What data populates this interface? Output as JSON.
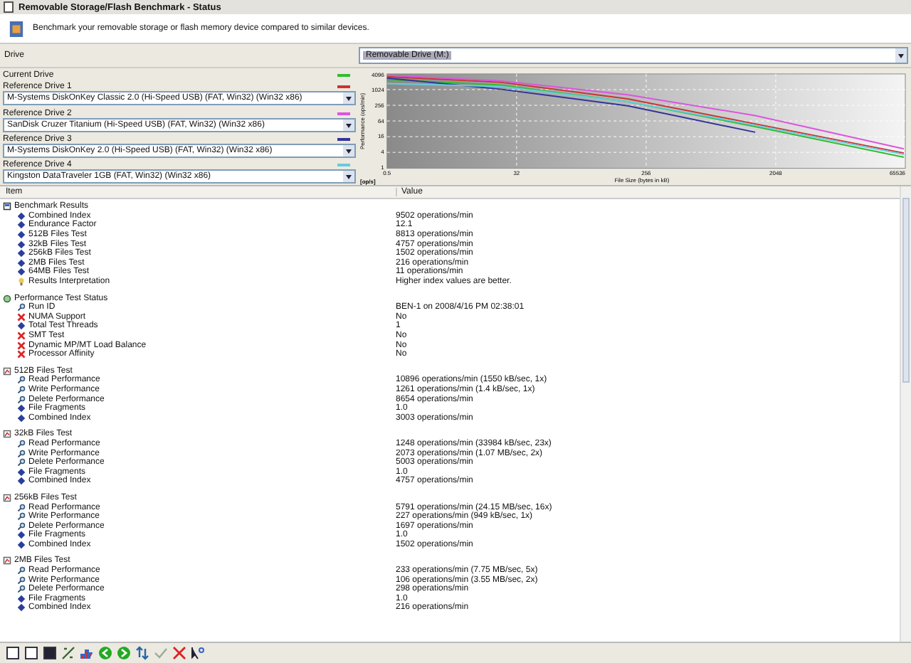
{
  "window": {
    "title": "Removable Storage/Flash Benchmark - Status"
  },
  "header": {
    "description": "Benchmark your removable storage or flash memory device compared to similar devices."
  },
  "drive": {
    "label": "Drive",
    "value": "Removable Drive (M:)"
  },
  "drives": [
    {
      "label": "Current Drive",
      "color": "#33bb33"
    },
    {
      "label": "Reference Drive 1",
      "color": "#cc3333",
      "value": "M-Systems DiskOnKey Classic 2.0 (Hi-Speed USB) (FAT, Win32) (Win32 x86)"
    },
    {
      "label": "Reference Drive 2",
      "color": "#dd55dd",
      "value": "SanDisk Cruzer Titanium (Hi-Speed USB) (FAT, Win32) (Win32 x86)"
    },
    {
      "label": "Reference Drive 3",
      "color": "#333399",
      "value": "M-Systems DiskOnKey 2.0 (Hi-Speed USB) (FAT, Win32) (Win32 x86)"
    },
    {
      "label": "Reference Drive 4",
      "color": "#66ccdd",
      "value": "Kingston DataTraveler 1GB (FAT, Win32) (Win32 x86)"
    }
  ],
  "chart": {
    "ylabel": "Performance (ops/min)",
    "xlabel": "File Size (bytes in kB)",
    "unit": "[op/s]",
    "yticks": [
      "4096",
      "1024",
      "256",
      "64",
      "16",
      "4",
      "1"
    ],
    "xticks": [
      "0.5",
      "32",
      "256",
      "2048",
      "65536"
    ]
  },
  "table": {
    "columns": [
      "Item",
      "Value"
    ],
    "sections": [
      {
        "label": "Benchmark Results",
        "kind": "results",
        "children": [
          {
            "label": "Combined Index",
            "value": "9502 operations/min",
            "kind": "result"
          },
          {
            "label": "Endurance Factor",
            "value": "12.1",
            "kind": "result"
          },
          {
            "label": "512B Files Test",
            "value": "8813 operations/min",
            "kind": "result"
          },
          {
            "label": "32kB Files Test",
            "value": "4757 operations/min",
            "kind": "result"
          },
          {
            "label": "256kB Files Test",
            "value": "1502 operations/min",
            "kind": "result"
          },
          {
            "label": "2MB Files Test",
            "value": "216 operations/min",
            "kind": "result"
          },
          {
            "label": "64MB Files Test",
            "value": "11 operations/min",
            "kind": "result"
          },
          {
            "label": "Results Interpretation",
            "value": "Higher index values are better.",
            "kind": "tip"
          }
        ]
      },
      {
        "label": "Performance Test Status",
        "kind": "status",
        "children": [
          {
            "label": "Run ID",
            "value": "BEN-1 on 2008/4/16 PM 02:38:01",
            "kind": "measure"
          },
          {
            "label": "NUMA Support",
            "value": "No",
            "kind": "unsupported"
          },
          {
            "label": "Total Test Threads",
            "value": "1",
            "kind": "result"
          },
          {
            "label": "SMT Test",
            "value": "No",
            "kind": "unsupported"
          },
          {
            "label": "Dynamic MP/MT Load Balance",
            "value": "No",
            "kind": "unsupported"
          },
          {
            "label": "Processor Affinity",
            "value": "No",
            "kind": "unsupported"
          }
        ]
      },
      {
        "label": "512B Files Test",
        "kind": "test",
        "children": [
          {
            "label": "Read Performance",
            "value": "10896 operations/min (1550 kB/sec, 1x)",
            "kind": "measure"
          },
          {
            "label": "Write Performance",
            "value": "1261 operations/min (1.4 kB/sec, 1x)",
            "kind": "measure"
          },
          {
            "label": "Delete Performance",
            "value": "8654 operations/min",
            "kind": "measure"
          },
          {
            "label": "File Fragments",
            "value": "1.0",
            "kind": "result"
          },
          {
            "label": "Combined Index",
            "value": "3003 operations/min",
            "kind": "result"
          }
        ]
      },
      {
        "label": "32kB Files Test",
        "kind": "test",
        "children": [
          {
            "label": "Read Performance",
            "value": "1248 operations/min (33984 kB/sec, 23x)",
            "kind": "measure"
          },
          {
            "label": "Write Performance",
            "value": "2073 operations/min (1.07 MB/sec, 2x)",
            "kind": "measure"
          },
          {
            "label": "Delete Performance",
            "value": "5003 operations/min",
            "kind": "measure"
          },
          {
            "label": "File Fragments",
            "value": "1.0",
            "kind": "result"
          },
          {
            "label": "Combined Index",
            "value": "4757 operations/min",
            "kind": "result"
          }
        ]
      },
      {
        "label": "256kB Files Test",
        "kind": "test",
        "children": [
          {
            "label": "Read Performance",
            "value": "5791 operations/min (24.15 MB/sec, 16x)",
            "kind": "measure"
          },
          {
            "label": "Write Performance",
            "value": "227 operations/min (949 kB/sec, 1x)",
            "kind": "measure"
          },
          {
            "label": "Delete Performance",
            "value": "1697 operations/min",
            "kind": "measure"
          },
          {
            "label": "File Fragments",
            "value": "1.0",
            "kind": "result"
          },
          {
            "label": "Combined Index",
            "value": "1502 operations/min",
            "kind": "result"
          }
        ]
      },
      {
        "label": "2MB Files Test",
        "kind": "test",
        "children": [
          {
            "label": "Read Performance",
            "value": "233 operations/min (7.75 MB/sec, 5x)",
            "kind": "measure"
          },
          {
            "label": "Write Performance",
            "value": "106 operations/min (3.55 MB/sec, 2x)",
            "kind": "measure"
          },
          {
            "label": "Delete Performance",
            "value": "298 operations/min",
            "kind": "measure"
          },
          {
            "label": "File Fragments",
            "value": "1.0",
            "kind": "result"
          },
          {
            "label": "Combined Index",
            "value": "216 operations/min",
            "kind": "result"
          }
        ]
      }
    ]
  }
}
